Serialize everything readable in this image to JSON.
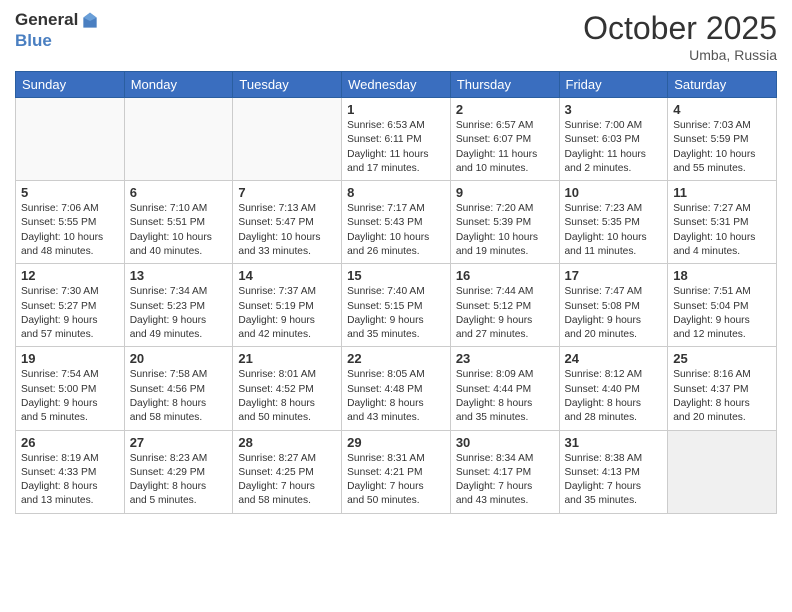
{
  "header": {
    "logo_line1": "General",
    "logo_line2": "Blue",
    "month": "October 2025",
    "location": "Umba, Russia"
  },
  "weekdays": [
    "Sunday",
    "Monday",
    "Tuesday",
    "Wednesday",
    "Thursday",
    "Friday",
    "Saturday"
  ],
  "weeks": [
    [
      {
        "day": "",
        "info": ""
      },
      {
        "day": "",
        "info": ""
      },
      {
        "day": "",
        "info": ""
      },
      {
        "day": "1",
        "info": "Sunrise: 6:53 AM\nSunset: 6:11 PM\nDaylight: 11 hours\nand 17 minutes."
      },
      {
        "day": "2",
        "info": "Sunrise: 6:57 AM\nSunset: 6:07 PM\nDaylight: 11 hours\nand 10 minutes."
      },
      {
        "day": "3",
        "info": "Sunrise: 7:00 AM\nSunset: 6:03 PM\nDaylight: 11 hours\nand 2 minutes."
      },
      {
        "day": "4",
        "info": "Sunrise: 7:03 AM\nSunset: 5:59 PM\nDaylight: 10 hours\nand 55 minutes."
      }
    ],
    [
      {
        "day": "5",
        "info": "Sunrise: 7:06 AM\nSunset: 5:55 PM\nDaylight: 10 hours\nand 48 minutes."
      },
      {
        "day": "6",
        "info": "Sunrise: 7:10 AM\nSunset: 5:51 PM\nDaylight: 10 hours\nand 40 minutes."
      },
      {
        "day": "7",
        "info": "Sunrise: 7:13 AM\nSunset: 5:47 PM\nDaylight: 10 hours\nand 33 minutes."
      },
      {
        "day": "8",
        "info": "Sunrise: 7:17 AM\nSunset: 5:43 PM\nDaylight: 10 hours\nand 26 minutes."
      },
      {
        "day": "9",
        "info": "Sunrise: 7:20 AM\nSunset: 5:39 PM\nDaylight: 10 hours\nand 19 minutes."
      },
      {
        "day": "10",
        "info": "Sunrise: 7:23 AM\nSunset: 5:35 PM\nDaylight: 10 hours\nand 11 minutes."
      },
      {
        "day": "11",
        "info": "Sunrise: 7:27 AM\nSunset: 5:31 PM\nDaylight: 10 hours\nand 4 minutes."
      }
    ],
    [
      {
        "day": "12",
        "info": "Sunrise: 7:30 AM\nSunset: 5:27 PM\nDaylight: 9 hours\nand 57 minutes."
      },
      {
        "day": "13",
        "info": "Sunrise: 7:34 AM\nSunset: 5:23 PM\nDaylight: 9 hours\nand 49 minutes."
      },
      {
        "day": "14",
        "info": "Sunrise: 7:37 AM\nSunset: 5:19 PM\nDaylight: 9 hours\nand 42 minutes."
      },
      {
        "day": "15",
        "info": "Sunrise: 7:40 AM\nSunset: 5:15 PM\nDaylight: 9 hours\nand 35 minutes."
      },
      {
        "day": "16",
        "info": "Sunrise: 7:44 AM\nSunset: 5:12 PM\nDaylight: 9 hours\nand 27 minutes."
      },
      {
        "day": "17",
        "info": "Sunrise: 7:47 AM\nSunset: 5:08 PM\nDaylight: 9 hours\nand 20 minutes."
      },
      {
        "day": "18",
        "info": "Sunrise: 7:51 AM\nSunset: 5:04 PM\nDaylight: 9 hours\nand 12 minutes."
      }
    ],
    [
      {
        "day": "19",
        "info": "Sunrise: 7:54 AM\nSunset: 5:00 PM\nDaylight: 9 hours\nand 5 minutes."
      },
      {
        "day": "20",
        "info": "Sunrise: 7:58 AM\nSunset: 4:56 PM\nDaylight: 8 hours\nand 58 minutes."
      },
      {
        "day": "21",
        "info": "Sunrise: 8:01 AM\nSunset: 4:52 PM\nDaylight: 8 hours\nand 50 minutes."
      },
      {
        "day": "22",
        "info": "Sunrise: 8:05 AM\nSunset: 4:48 PM\nDaylight: 8 hours\nand 43 minutes."
      },
      {
        "day": "23",
        "info": "Sunrise: 8:09 AM\nSunset: 4:44 PM\nDaylight: 8 hours\nand 35 minutes."
      },
      {
        "day": "24",
        "info": "Sunrise: 8:12 AM\nSunset: 4:40 PM\nDaylight: 8 hours\nand 28 minutes."
      },
      {
        "day": "25",
        "info": "Sunrise: 8:16 AM\nSunset: 4:37 PM\nDaylight: 8 hours\nand 20 minutes."
      }
    ],
    [
      {
        "day": "26",
        "info": "Sunrise: 8:19 AM\nSunset: 4:33 PM\nDaylight: 8 hours\nand 13 minutes."
      },
      {
        "day": "27",
        "info": "Sunrise: 8:23 AM\nSunset: 4:29 PM\nDaylight: 8 hours\nand 5 minutes."
      },
      {
        "day": "28",
        "info": "Sunrise: 8:27 AM\nSunset: 4:25 PM\nDaylight: 7 hours\nand 58 minutes."
      },
      {
        "day": "29",
        "info": "Sunrise: 8:31 AM\nSunset: 4:21 PM\nDaylight: 7 hours\nand 50 minutes."
      },
      {
        "day": "30",
        "info": "Sunrise: 8:34 AM\nSunset: 4:17 PM\nDaylight: 7 hours\nand 43 minutes."
      },
      {
        "day": "31",
        "info": "Sunrise: 8:38 AM\nSunset: 4:13 PM\nDaylight: 7 hours\nand 35 minutes."
      },
      {
        "day": "",
        "info": ""
      }
    ]
  ]
}
